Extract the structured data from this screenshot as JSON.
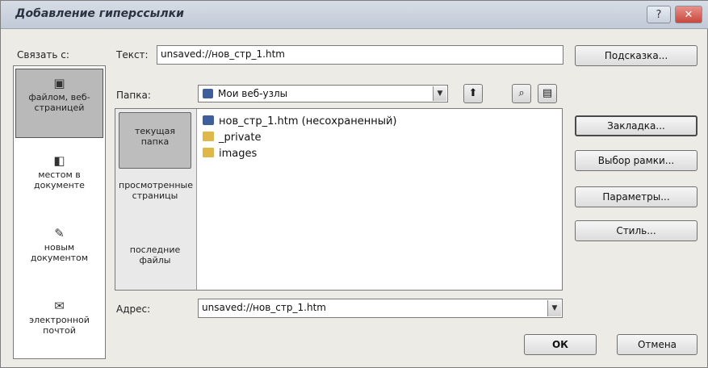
{
  "window": {
    "title": "Добавление гиперссылки",
    "help": "?",
    "close": "✕"
  },
  "link_to": {
    "label": "Связать с:",
    "items": [
      {
        "label": "файлом, веб-страницей",
        "icon": "web-page-icon"
      },
      {
        "label": "местом в документе",
        "icon": "document-place-icon"
      },
      {
        "label": "новым документом",
        "icon": "new-document-icon"
      },
      {
        "label": "электронной почтой",
        "icon": "email-icon"
      }
    ]
  },
  "text_field": {
    "label": "Текст:",
    "value": "unsaved://нов_стр_1.htm"
  },
  "folder": {
    "label": "Папка:",
    "value": "Мои веб-узлы",
    "tools": {
      "up": "folder-up-icon",
      "web": "web-search-icon",
      "browse": "browse-folder-icon"
    }
  },
  "browse_panel": {
    "sections": [
      "текущая папка",
      "просмотренные страницы",
      "последние файлы"
    ],
    "files": [
      {
        "name": "нов_стр_1.htm (несохраненный)",
        "type": "page"
      },
      {
        "name": "_private",
        "type": "folder"
      },
      {
        "name": "images",
        "type": "folder"
      }
    ]
  },
  "address": {
    "label": "Адрес:",
    "value": "unsaved://нов_стр_1.htm"
  },
  "buttons": {
    "tooltip": "Подсказка...",
    "bookmark": "Закладка...",
    "frame": "Выбор рамки...",
    "params": "Параметры...",
    "style": "Стиль...",
    "ok": "ОК",
    "cancel": "Отмена"
  }
}
